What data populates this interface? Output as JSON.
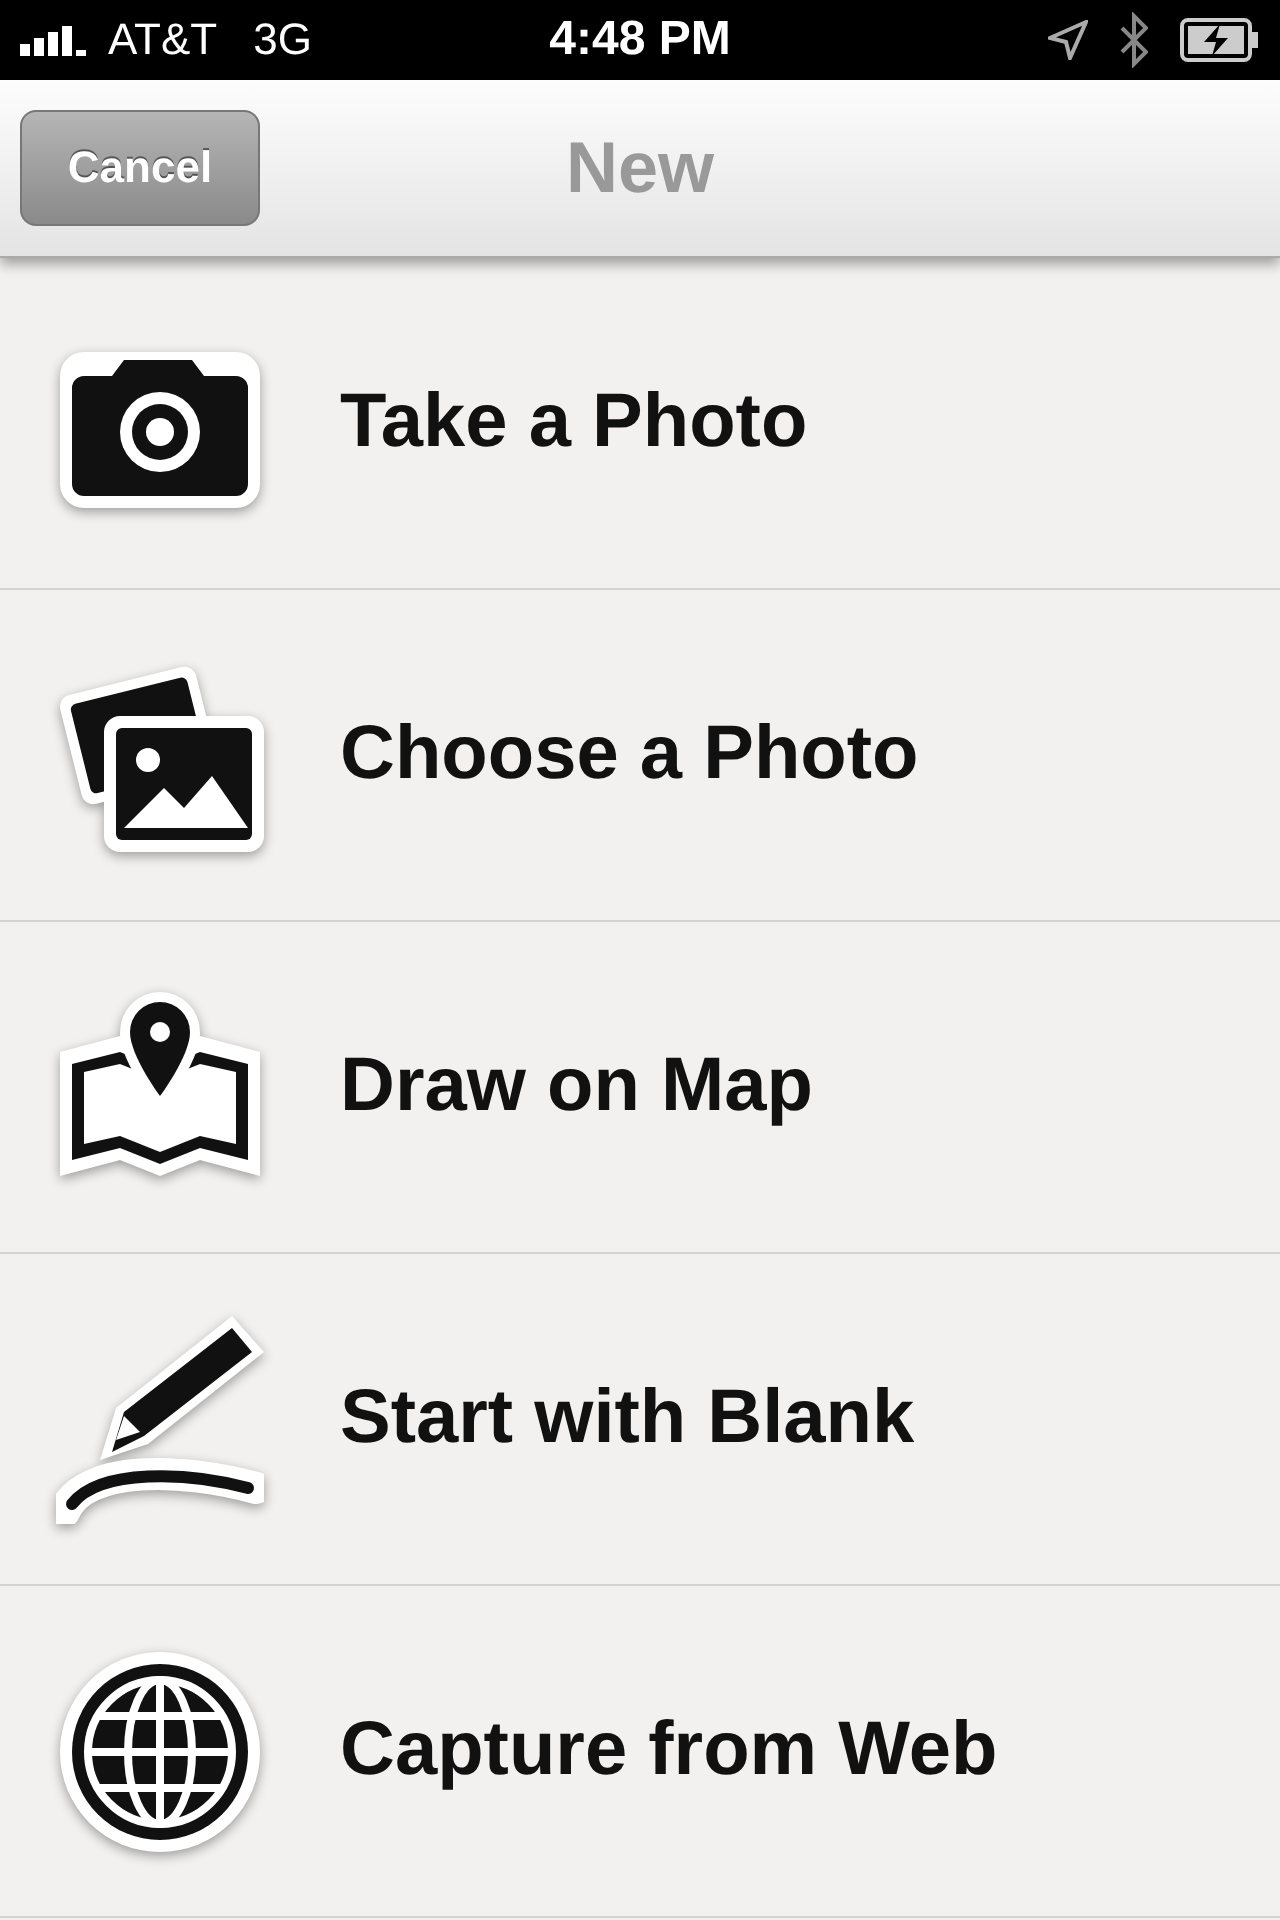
{
  "status_bar": {
    "carrier": "AT&T",
    "network": "3G",
    "time": "4:48 PM"
  },
  "nav_bar": {
    "cancel": "Cancel",
    "title": "New"
  },
  "items": [
    {
      "kind": "camera",
      "label": "Take a Photo"
    },
    {
      "kind": "photos",
      "label": "Choose a Photo"
    },
    {
      "kind": "map",
      "label": "Draw on Map"
    },
    {
      "kind": "pen",
      "label": "Start with Blank"
    },
    {
      "kind": "globe",
      "label": "Capture from Web"
    }
  ]
}
